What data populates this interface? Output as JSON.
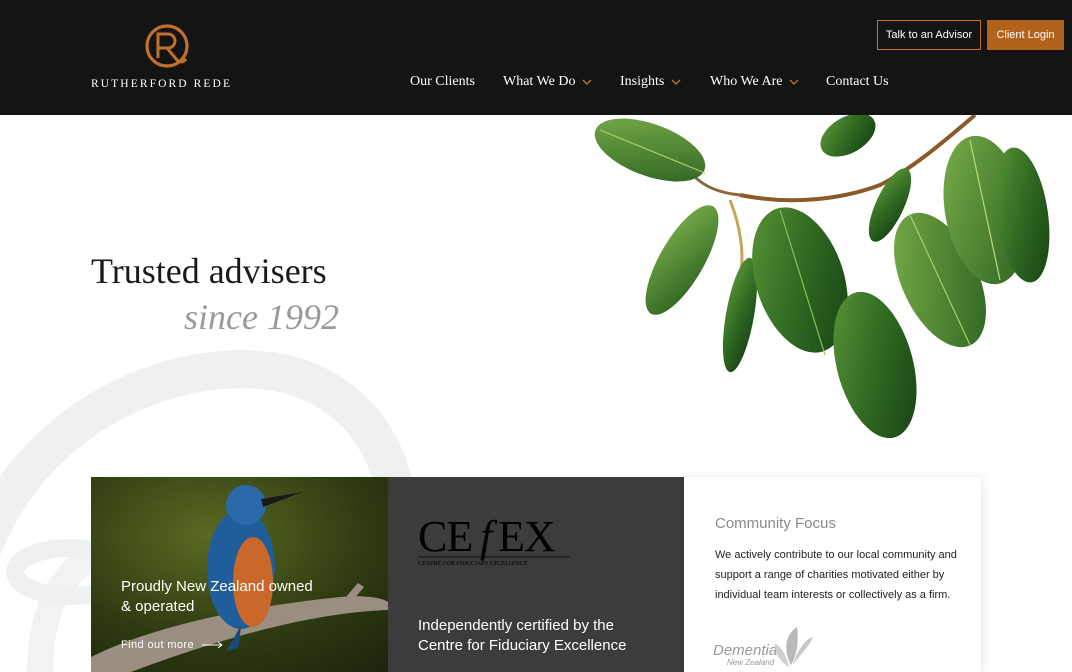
{
  "brand": {
    "name": "RUTHERFORD REDE",
    "logo_icon": "monogram-r-icon",
    "accent_color": "#b3621c"
  },
  "header": {
    "advisor_button": "Talk to an Advisor",
    "login_button": "Client Login"
  },
  "nav": {
    "items": [
      {
        "label": "Our Clients",
        "dropdown": false
      },
      {
        "label": "What We Do",
        "dropdown": true
      },
      {
        "label": "Insights",
        "dropdown": true
      },
      {
        "label": "Who We Are",
        "dropdown": true
      },
      {
        "label": "Contact Us",
        "dropdown": false
      }
    ]
  },
  "hero": {
    "title": "Trusted advisers",
    "subtitle": "since 1992",
    "image": "rubber-plant-leaves"
  },
  "cards": {
    "nz": {
      "text": "Proudly New Zealand owned & operated",
      "link": "Find out more",
      "image": "kingfisher-bird"
    },
    "cefex": {
      "logo_main": "CEFEX",
      "logo_tagline": "CENTRE FOR FIDUCIARY EXCELLENCE",
      "text": "Independently certified by the Centre for Fiduciary Excellence"
    },
    "community": {
      "title": "Community Focus",
      "body": "We actively contribute to our local community and support a range of charities motivated either by individual team interests or collectively as a firm.",
      "partner_logo": "Dementia",
      "partner_sub": "New Zealand"
    }
  }
}
